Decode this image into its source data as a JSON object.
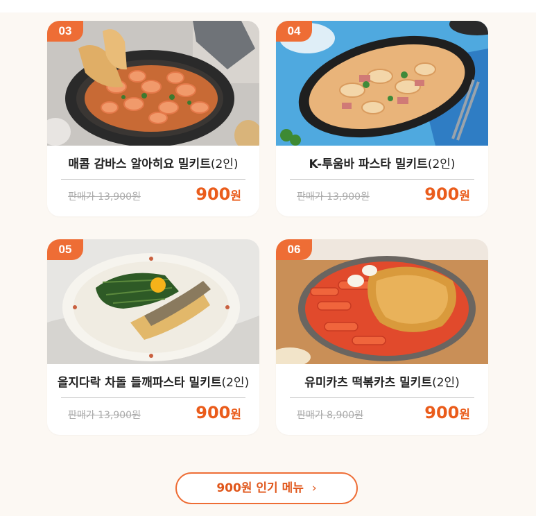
{
  "products": [
    {
      "number": "03",
      "name": "매콤 감바스 알아히요 밀키트",
      "serving": "(2인)",
      "original_price": "판매가 13,900원",
      "price": "900",
      "price_unit": "원",
      "image": "garlic-shrimp-skillet"
    },
    {
      "number": "04",
      "name": "K-투움바 파스타 밀키트",
      "serving": "(2인)",
      "original_price": "판매가 13,900원",
      "price": "900",
      "price_unit": "원",
      "image": "cream-pasta-platter"
    },
    {
      "number": "05",
      "name": "을지다락 차돌 들깨파스타 밀키트",
      "serving": "(2인)",
      "original_price": "판매가 13,900원",
      "price": "900",
      "price_unit": "원",
      "image": "perilla-pasta-plate"
    },
    {
      "number": "06",
      "name": "유미카츠 떡볶카츠 밀키트",
      "serving": "(2인)",
      "original_price": "판매가 8,900원",
      "price": "900",
      "price_unit": "원",
      "image": "tteokbokki-cutlet"
    }
  ],
  "more_button": {
    "label": "900원 인기 메뉴",
    "icon": "chevron-right-icon",
    "icon_glyph": "›"
  },
  "colors": {
    "accent": "#ee6d35",
    "price": "#ea5c1b",
    "background": "#fcf8f3"
  }
}
